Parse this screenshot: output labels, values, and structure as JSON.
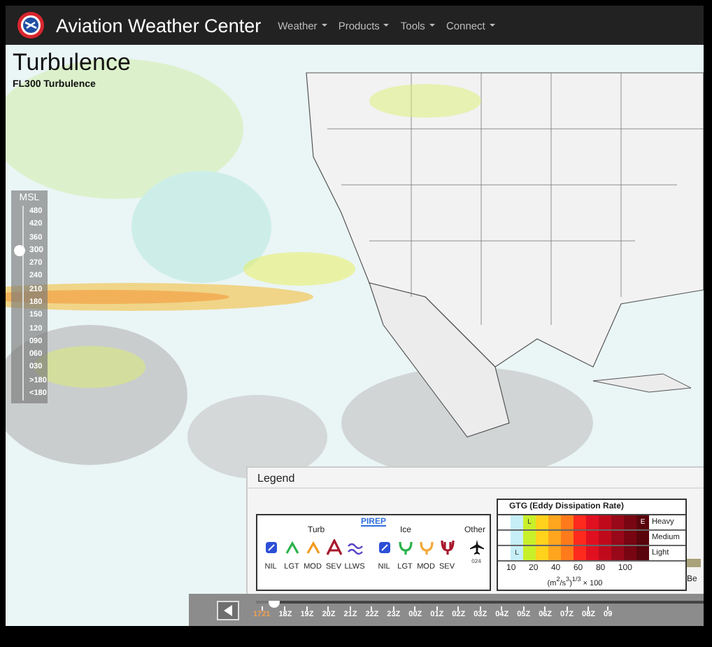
{
  "header": {
    "title": "Aviation Weather Center",
    "menu": [
      {
        "label": "Weather"
      },
      {
        "label": "Products"
      },
      {
        "label": "Tools"
      },
      {
        "label": "Connect"
      }
    ]
  },
  "page": {
    "title": "Turbulence",
    "subtitle": "FL300 Turbulence"
  },
  "altitude_slider": {
    "label": "MSL",
    "ticks": [
      {
        "label": "480",
        "selected": false
      },
      {
        "label": "420",
        "selected": false
      },
      {
        "label": "360",
        "selected": false
      },
      {
        "label": "300",
        "selected": true
      },
      {
        "label": "270",
        "selected": false
      },
      {
        "label": "240",
        "selected": false
      },
      {
        "label": "210",
        "selected": false
      },
      {
        "label": "180",
        "selected": false
      },
      {
        "label": "150",
        "selected": false
      },
      {
        "label": "120",
        "selected": false
      },
      {
        "label": "090",
        "selected": false
      },
      {
        "label": "060",
        "selected": false
      },
      {
        "label": "030",
        "selected": false
      },
      {
        "label": ">180",
        "selected": false
      },
      {
        "label": "<180",
        "selected": false
      }
    ]
  },
  "legend": {
    "title": "Legend",
    "pirep": {
      "title": "PIREP",
      "groups": [
        {
          "label": "Turb"
        },
        {
          "label": "Ice"
        },
        {
          "label": "Other"
        }
      ],
      "symbols": [
        {
          "kind": "turb-nil",
          "label": "NIL",
          "color": "#2d4fd6"
        },
        {
          "kind": "turb",
          "label": "LGT",
          "color": "#2bb24c"
        },
        {
          "kind": "turb",
          "label": "MOD",
          "color": "#f29a1e"
        },
        {
          "kind": "turb-sev",
          "label": "SEV",
          "color": "#a8182b"
        },
        {
          "kind": "llws",
          "label": "LLWS",
          "color": "#5a46c8"
        },
        {
          "kind": "ice-nil",
          "label": "NIL",
          "color": "#2d4fd6"
        },
        {
          "kind": "ice",
          "label": "LGT",
          "color": "#2bb24c"
        },
        {
          "kind": "ice",
          "label": "MOD",
          "color": "#f2a93a"
        },
        {
          "kind": "ice-sev",
          "label": "SEV",
          "color": "#a8182b"
        }
      ],
      "other": {
        "label": "024"
      }
    },
    "gtg": {
      "title": "GTG (Eddy Dissipation Rate)",
      "scale": [
        {
          "color": "#c6eef6"
        },
        {
          "color": "#c8f02a"
        },
        {
          "color": "#ffd21c"
        },
        {
          "color": "#ffa51e"
        },
        {
          "color": "#ff7a1a"
        },
        {
          "color": "#ff2a1e"
        },
        {
          "color": "#e01020"
        },
        {
          "color": "#c00a1c"
        },
        {
          "color": "#980818"
        },
        {
          "color": "#780612"
        },
        {
          "color": "#5a040c"
        }
      ],
      "rows": [
        {
          "label": "Heavy",
          "cells": [
            {},
            {
              "text": "L"
            },
            {},
            {},
            {},
            {},
            {},
            {},
            {},
            {},
            {
              "text": "E"
            }
          ]
        },
        {
          "label": "Medium",
          "cells": [
            {},
            {},
            {},
            {},
            {},
            {},
            {},
            {},
            {},
            {},
            {}
          ]
        },
        {
          "label": "Light",
          "cells": [
            {
              "text": "L"
            },
            {},
            {},
            {},
            {},
            {},
            {},
            {},
            {},
            {},
            {}
          ]
        }
      ],
      "axis": [
        "10",
        "20",
        "40",
        "60",
        "80",
        "100"
      ],
      "unit": "(m$^{2}$/s$^{3}$)$^{1/3}$ × 100"
    },
    "side_label": "Be"
  },
  "timeline": {
    "level": 0.04,
    "steps": [
      {
        "label": "1721",
        "selected": true
      },
      {
        "label": "18Z",
        "selected": false
      },
      {
        "label": "19Z",
        "selected": false
      },
      {
        "label": "20Z",
        "selected": false
      },
      {
        "label": "21Z",
        "selected": false
      },
      {
        "label": "22Z",
        "selected": false
      },
      {
        "label": "23Z",
        "selected": false
      },
      {
        "label": "00Z",
        "selected": false
      },
      {
        "label": "01Z",
        "selected": false
      },
      {
        "label": "02Z",
        "selected": false
      },
      {
        "label": "03Z",
        "selected": false
      },
      {
        "label": "04Z",
        "selected": false
      },
      {
        "label": "05Z",
        "selected": false
      },
      {
        "label": "06Z",
        "selected": false
      },
      {
        "label": "07Z",
        "selected": false
      },
      {
        "label": "08Z",
        "selected": false
      },
      {
        "label": "09",
        "selected": false
      }
    ]
  }
}
